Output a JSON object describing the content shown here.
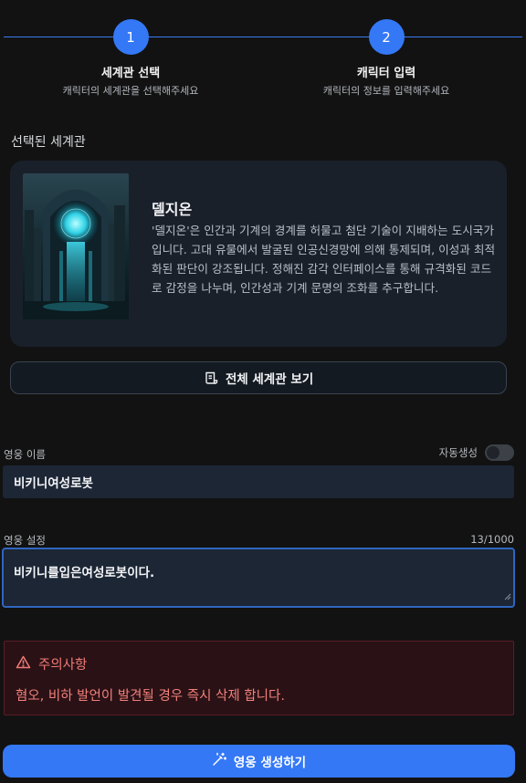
{
  "stepper": {
    "steps": [
      {
        "number": "1",
        "title": "세계관 선택",
        "subtitle": "캐릭터의 세계관을 선택해주세요"
      },
      {
        "number": "2",
        "title": "캐릭터 입력",
        "subtitle": "캐릭터의 정보를 입력해주세요"
      }
    ],
    "accent_color": "#3478f6"
  },
  "selected_world": {
    "section_label": "선택된 세계관",
    "name": "델지온",
    "description": "'델지온'은 인간과 기계의 경계를 허물고 첨단 기술이 지배하는 도시국가입니다. 고대 유물에서 발굴된 인공신경망에 의해 통제되며, 이성과 최적화된 판단이 강조됩니다. 정해진 감각 인터페이스를 통해 규격화된 코드로 감정을 나누며, 인간성과 기계 문명의 조화를 추구합니다.",
    "view_button_label": "전체 세계관 보기",
    "view_button_icon": "scroll-icon"
  },
  "hero_form": {
    "name_label": "영웅 이름",
    "auto_generate_label": "자동생성",
    "auto_generate_on": false,
    "name_value": "비키니여성로봇",
    "setting_label": "영웅 설정",
    "setting_counter": "13/1000",
    "setting_value": "비키니를입은여성로봇이다."
  },
  "warning": {
    "icon": "warning-triangle-icon",
    "title": "주의사항",
    "text": "혐오, 비하 발언이 발견될 경우 즉시 삭제 합니다.",
    "color": "#f07b75"
  },
  "create_button": {
    "label": "영웅 생성하기",
    "icon": "magic-wand-icon",
    "color": "#3478f6"
  }
}
